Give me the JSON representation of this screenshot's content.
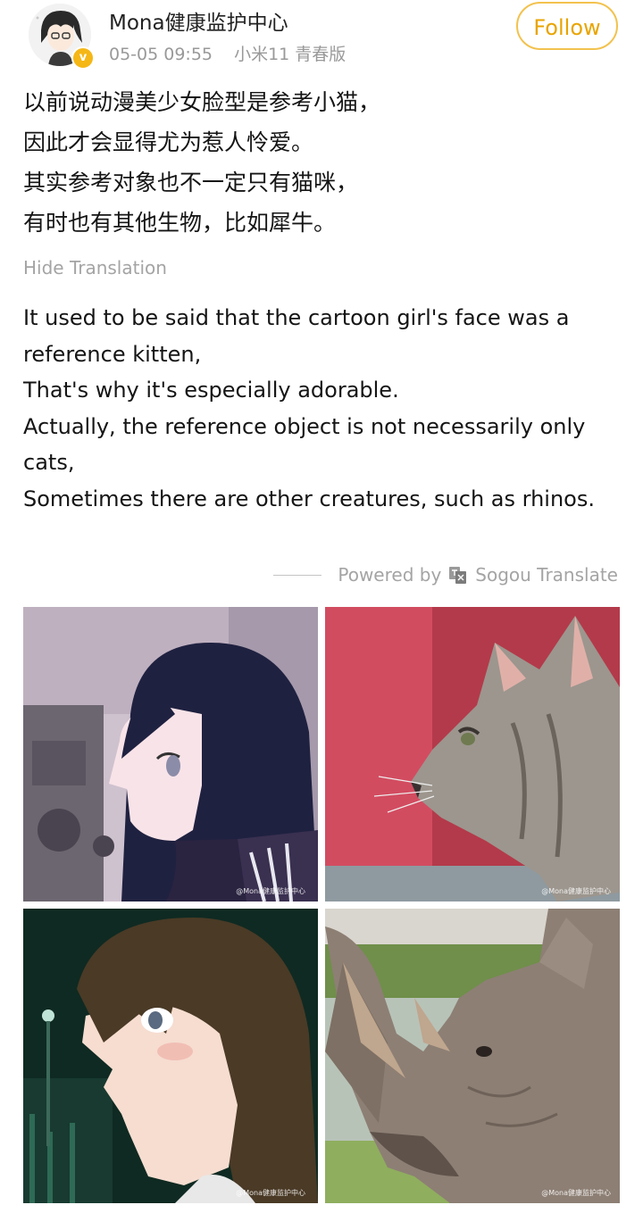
{
  "post": {
    "username": "Mona健康监护中心",
    "date": "05-05 09:55",
    "device": "小米11 青春版",
    "follow_label": "Follow",
    "verified_badge": "v"
  },
  "original_text": [
    "以前说动漫美少女脸型是参考小猫，",
    "因此才会显得尤为惹人怜爱。",
    "其实参考对象也不一定只有猫咪，",
    "有时也有其他生物，比如犀牛。"
  ],
  "hide_translation_label": "Hide Translation",
  "translated_text": [
    "It used to be said that the cartoon girl's face was a reference kitten,",
    "That's why it's especially adorable.",
    "Actually, the reference object is not necessarily only cats,",
    "Sometimes there are other creatures, such as rhinos."
  ],
  "powered_by": {
    "prefix": "Powered by",
    "service": "Sogou Translate"
  },
  "images": [
    {
      "name": "anime-girl-profile-image",
      "watermark": "@Mona健康监护中心"
    },
    {
      "name": "cat-profile-image",
      "watermark": "@Mona健康监护中心"
    },
    {
      "name": "anime-boy-profile-image",
      "watermark": "@Mona健康监护中心"
    },
    {
      "name": "rhino-profile-image",
      "watermark": "@Mona健康监护中心"
    }
  ],
  "colors": {
    "follow_accent": "#e8a400",
    "meta_gray": "#999999",
    "verified_badge": "#f5b716"
  }
}
